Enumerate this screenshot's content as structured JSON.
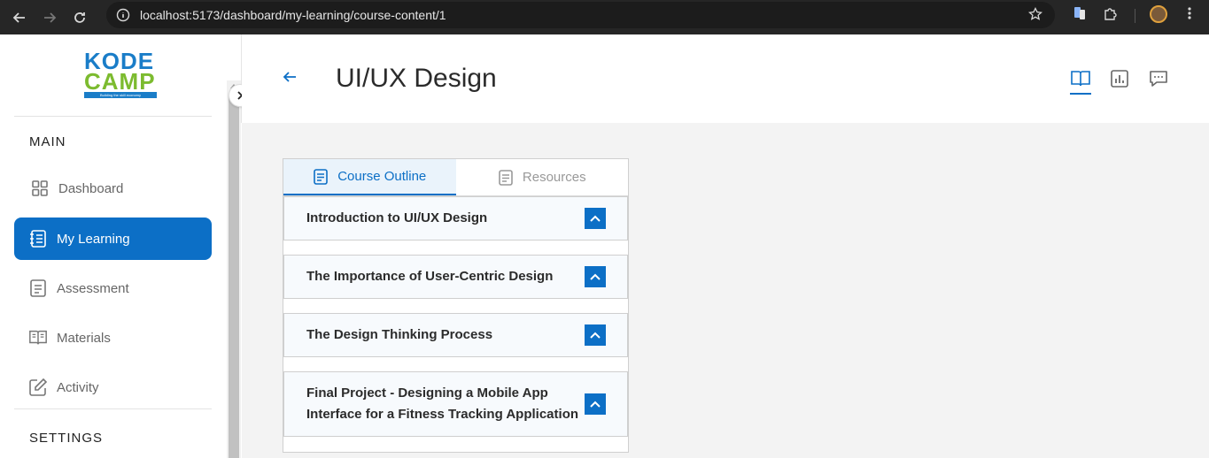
{
  "browser": {
    "url": "localhost:5173/dashboard/my-learning/course-content/1"
  },
  "sidebar": {
    "logo": {
      "line1": "KODE",
      "line2": "CAMP",
      "tagline": "Building the skill economy"
    },
    "main_section": "MAIN",
    "items": [
      {
        "label": "Dashboard",
        "icon": "grid-icon"
      },
      {
        "label": "My Learning",
        "icon": "notebook-icon",
        "active": true
      },
      {
        "label": "Assessment",
        "icon": "document-icon"
      },
      {
        "label": "Materials",
        "icon": "open-book-icon"
      },
      {
        "label": "Activity",
        "icon": "edit-icon"
      }
    ],
    "settings_section": "SETTINGS"
  },
  "header": {
    "title": "UI/UX Design",
    "icons": [
      "book-icon",
      "chart-icon",
      "chat-icon"
    ]
  },
  "course": {
    "tabs": [
      {
        "label": "Course Outline",
        "active": true
      },
      {
        "label": "Resources",
        "active": false
      }
    ],
    "modules": [
      {
        "title": "Introduction to UI/UX Design"
      },
      {
        "title": "The Importance of User-Centric Design"
      },
      {
        "title": "The Design Thinking Process"
      },
      {
        "title": "Final Project - Designing a Mobile App Interface for a Fitness Tracking Application"
      }
    ]
  },
  "colors": {
    "accent": "#0c6fc6",
    "logo_blue": "#1a7dc8",
    "logo_green": "#7cbb2f"
  }
}
